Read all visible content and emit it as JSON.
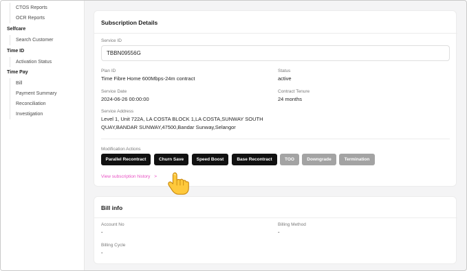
{
  "sidebar": {
    "top_items": [
      "CTOS Reports",
      "OCR Reports"
    ],
    "groups": [
      {
        "title": "Selfcare",
        "items": [
          "Search Customer"
        ]
      },
      {
        "title": "Time ID",
        "items": [
          "Activation Status"
        ]
      },
      {
        "title": "Time Pay",
        "items": [
          "Bill",
          "Payment Summary",
          "Reconciliation",
          "Investigation"
        ]
      }
    ]
  },
  "subscription": {
    "title": "Subscription Details",
    "service_id_label": "Service ID",
    "service_id_value": "TBBN09556G",
    "plan_id_label": "Plan ID",
    "plan_id_value": "Time Fibre Home 600Mbps-24m contract",
    "status_label": "Status",
    "status_value": "active",
    "service_date_label": "Service Date",
    "service_date_value": "2024-06-26 00:00:00",
    "contract_tenure_label": "Contract Tenure",
    "contract_tenure_value": "24 months",
    "service_address_label": "Service Address",
    "service_address_line1": "Level 1, Unit 722A, LA COSTA BLOCK 1,LA COSTA,SUNWAY SOUTH",
    "service_address_line2": "QUAY,BANDAR SUNWAY,47500,Bandar Sunway,Selangor",
    "modification_label": "Modification Actions",
    "actions": [
      {
        "label": "Parallel Recontract",
        "enabled": true
      },
      {
        "label": "Churn Save",
        "enabled": true
      },
      {
        "label": "Speed Boost",
        "enabled": true
      },
      {
        "label": "Base Recontract",
        "enabled": true
      },
      {
        "label": "TOO",
        "enabled": false
      },
      {
        "label": "Downgrade",
        "enabled": false
      },
      {
        "label": "Termination",
        "enabled": false
      }
    ],
    "history_link": "View subscription history",
    "history_link_arrow": ">"
  },
  "bill": {
    "title": "Bill info",
    "account_no_label": "Account No",
    "account_no_value": "-",
    "billing_method_label": "Billing Method",
    "billing_method_value": "-",
    "billing_cycle_label": "Billing Cycle",
    "billing_cycle_value": "-"
  },
  "colors": {
    "link": "#e84fc3",
    "button_dark": "#111111",
    "button_disabled": "#a3a3a3",
    "background": "#f4f4f5"
  },
  "cursor_icon": "pointing-hand-icon"
}
